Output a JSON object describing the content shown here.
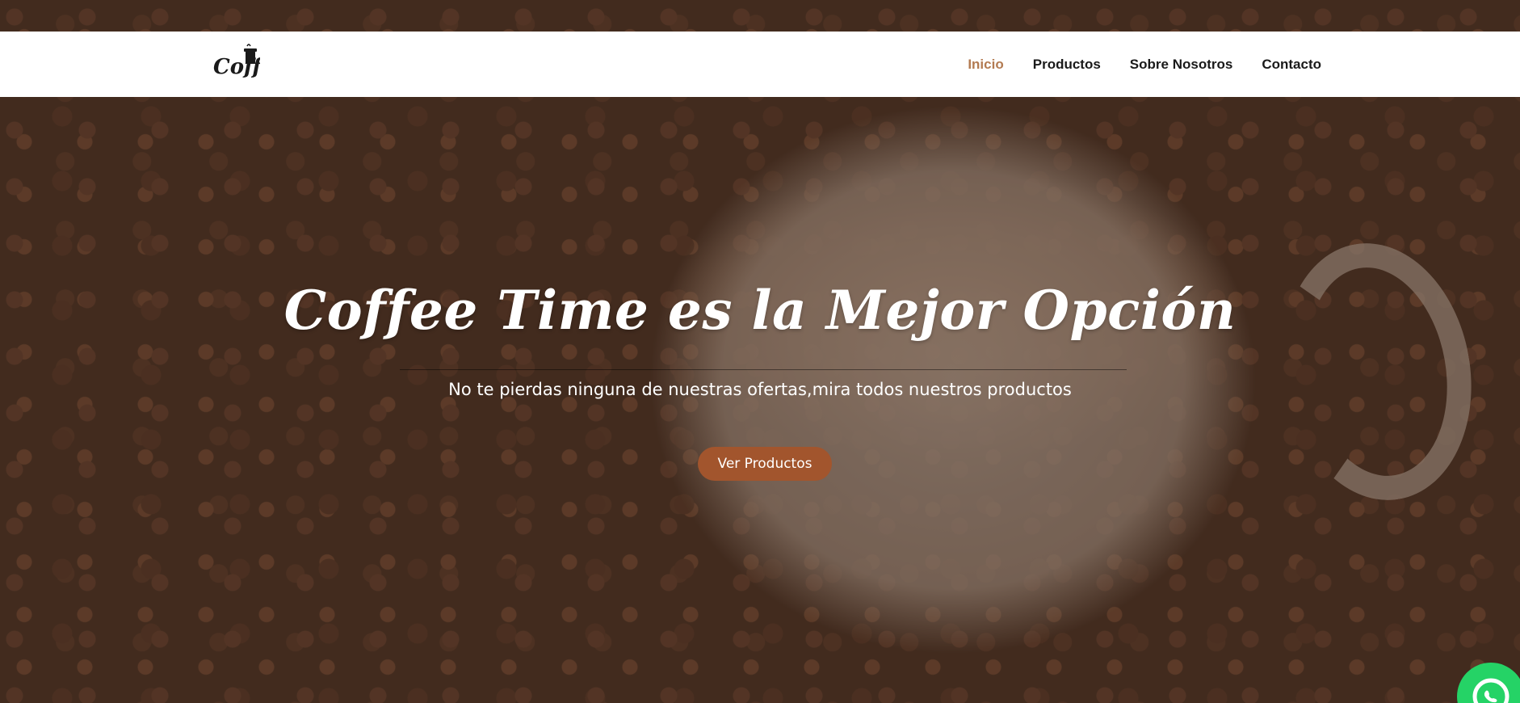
{
  "brand": {
    "logo_icon": "coffee-cup-logo-icon",
    "logo_text": "Coffee Time"
  },
  "nav": {
    "items": [
      {
        "label": "Inicio",
        "active": true
      },
      {
        "label": "Productos",
        "active": false
      },
      {
        "label": "Sobre Nosotros",
        "active": false
      },
      {
        "label": "Contacto",
        "active": false
      }
    ]
  },
  "hero": {
    "title": "Coffee Time es la Mejor Opción",
    "subtitle": "No te pierdas ninguna de nuestras ofertas,mira todos nuestros productos",
    "button_label": "Ver Productos"
  },
  "floating": {
    "whatsapp_icon": "whatsapp-icon"
  },
  "colors": {
    "accent": "#b37b52",
    "button": "#a2552d",
    "nav_bg": "#ffffff",
    "whatsapp": "#25d366"
  }
}
